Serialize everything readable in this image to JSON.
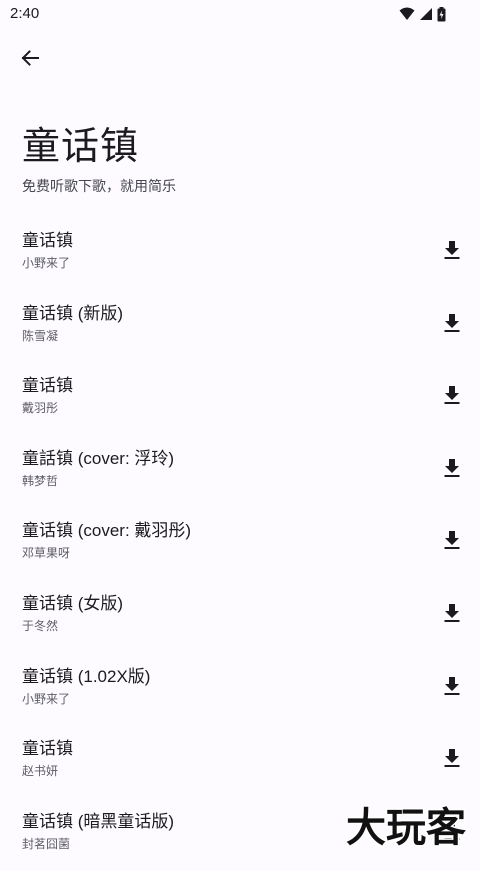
{
  "status_bar": {
    "time": "2:40",
    "icons": [
      "wifi-icon",
      "cell-signal-icon",
      "battery-charging-icon"
    ]
  },
  "header": {
    "back_icon": "arrow-left-icon",
    "title": "童话镇",
    "subtitle": "免费听歌下歌，就用简乐"
  },
  "songs": [
    {
      "title": "童话镇",
      "artist": "小野来了"
    },
    {
      "title": "童话镇 (新版)",
      "artist": "陈雪凝"
    },
    {
      "title": "童话镇",
      "artist": "戴羽彤"
    },
    {
      "title": "童話镇 (cover: 浮玲)",
      "artist": "韩梦哲"
    },
    {
      "title": "童话镇 (cover: 戴羽彤)",
      "artist": "邓草果呀"
    },
    {
      "title": "童话镇 (女版)",
      "artist": "于冬然"
    },
    {
      "title": "童话镇 (1.02X版)",
      "artist": "小野来了"
    },
    {
      "title": "童话镇",
      "artist": "赵书妍"
    },
    {
      "title": "童话镇 (暗黑童话版)",
      "artist": "封茗囧菌"
    }
  ],
  "download_icon": "download-icon",
  "watermark": {
    "text": "大玩客"
  },
  "colors": {
    "background": "#fdfbff",
    "text": "#1b1b1f",
    "secondary_text": "#5d5e67"
  }
}
